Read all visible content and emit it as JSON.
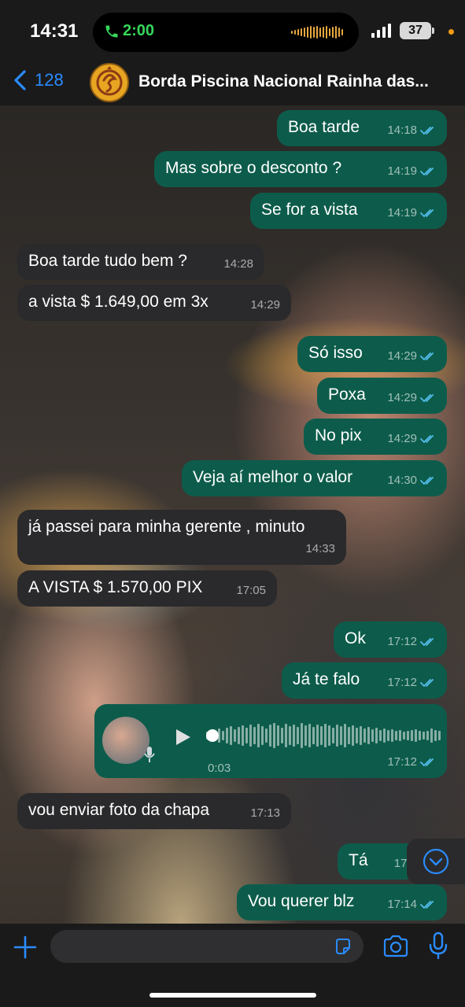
{
  "status": {
    "time": "14:31",
    "call_duration": "2:00",
    "battery": "37"
  },
  "header": {
    "back_count": "128",
    "contact_name": "Borda Piscina Nacional Rainha das..."
  },
  "messages": [
    {
      "dir": "out",
      "text": "Boa tarde",
      "time": "14:18",
      "read": true
    },
    {
      "dir": "out",
      "text": "Mas sobre o desconto ?",
      "time": "14:19",
      "read": true
    },
    {
      "dir": "out",
      "text": "Se for a vista",
      "time": "14:19",
      "read": true
    },
    {
      "dir": "in",
      "text": "Boa tarde tudo bem ?",
      "time": "14:28"
    },
    {
      "dir": "in",
      "text": "a vista $ 1.649,00 em 3x",
      "time": "14:29"
    },
    {
      "dir": "out",
      "text": "Só isso",
      "time": "14:29",
      "read": true
    },
    {
      "dir": "out",
      "text": "Poxa",
      "time": "14:29",
      "read": true
    },
    {
      "dir": "out",
      "text": "No pix",
      "time": "14:29",
      "read": true
    },
    {
      "dir": "out",
      "text": "Veja aí melhor o valor",
      "time": "14:30",
      "read": true
    },
    {
      "dir": "in",
      "text": "já passei para minha gerente , minuto",
      "time": "14:33"
    },
    {
      "dir": "in",
      "text": "A VISTA $ 1.570,00 PIX",
      "time": "17:05"
    },
    {
      "dir": "out",
      "text": "Ok",
      "time": "17:12",
      "read": true
    },
    {
      "dir": "out",
      "text": "Já te falo",
      "time": "17:12",
      "read": true
    },
    {
      "dir": "out",
      "type": "voice",
      "duration": "0:03",
      "time": "17:12",
      "read": true
    },
    {
      "dir": "in",
      "text": "vou enviar foto da chapa",
      "time": "17:13"
    },
    {
      "dir": "out",
      "text": "Tá",
      "time": "17:1",
      "read": true
    },
    {
      "dir": "out",
      "text": "Vou querer blz",
      "time": "17:14",
      "read": true
    }
  ],
  "composer": {
    "placeholder": ""
  },
  "colors": {
    "outgoing_bubble": "#0d5c4b",
    "incoming_bubble": "#2a2a2c",
    "accent": "#2a8cff",
    "read_ticks": "#53bdeb"
  }
}
